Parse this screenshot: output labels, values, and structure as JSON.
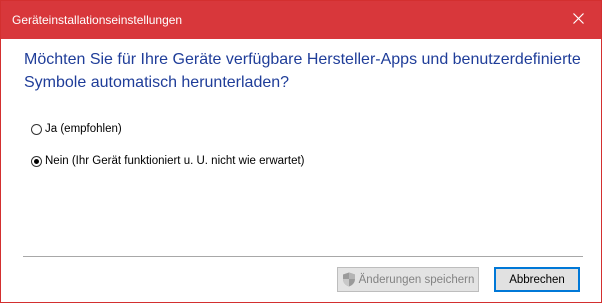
{
  "window": {
    "title": "Geräteinstallationseinstellungen",
    "close_icon": "close-icon"
  },
  "main": {
    "question": "Möchten Sie für Ihre Geräte verfügbare Hersteller-Apps und benutzerdefinierte Symbole automatisch herunterladen?",
    "options": [
      {
        "label": "Ja (empfohlen)",
        "selected": false
      },
      {
        "label": "Nein (Ihr Gerät funktioniert u. U. nicht wie erwartet)",
        "selected": true
      }
    ]
  },
  "footer": {
    "save_label": "Änderungen speichern",
    "save_enabled": false,
    "save_icon": "uac-shield-icon",
    "cancel_label": "Abbrechen"
  },
  "colors": {
    "titlebar": "#d8373b",
    "heading": "#1f3d99",
    "focus_border": "#0078d7"
  }
}
